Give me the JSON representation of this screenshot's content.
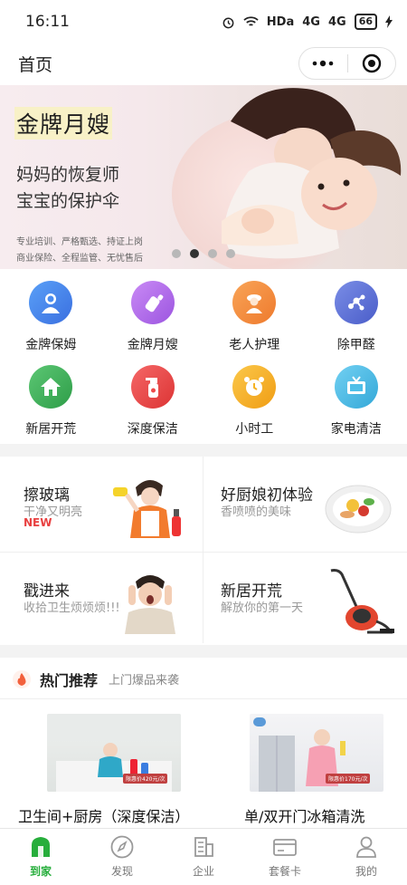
{
  "status_bar": {
    "time": "16:11",
    "network": "HDa",
    "signal1": "4G",
    "signal2": "4G",
    "battery": "66"
  },
  "navbar": {
    "title": "首页"
  },
  "banner": {
    "headline": "金牌月嫂",
    "line1": "妈妈的恢复师",
    "line2": "宝宝的保护伞",
    "small1": "专业培训、严格甄选、持证上岗",
    "small2": "商业保险、全程监管、无忧售后",
    "page_count": 4,
    "current_page": 2
  },
  "services": [
    {
      "label": "金牌保姆",
      "icon": "nanny-icon",
      "color": "#4a8cf0"
    },
    {
      "label": "金牌月嫂",
      "icon": "baby-bottle-icon",
      "color": "#b06ae8"
    },
    {
      "label": "老人护理",
      "icon": "elderly-care-icon",
      "color": "#f48a3a"
    },
    {
      "label": "除甲醛",
      "icon": "molecule-icon",
      "color": "#5b6fd8"
    },
    {
      "label": "新居开荒",
      "icon": "house-icon",
      "color": "#3fb35a"
    },
    {
      "label": "深度保洁",
      "icon": "spray-bottle-icon",
      "color": "#ee4a4a"
    },
    {
      "label": "小时工",
      "icon": "alarm-clock-icon",
      "color": "#f5b324"
    },
    {
      "label": "家电清洁",
      "icon": "tv-icon",
      "color": "#4fbfe8"
    }
  ],
  "promos": [
    {
      "title": "擦玻璃",
      "subtitle": "干净又明亮",
      "badge": "NEW",
      "image": "window-cleaning-icon"
    },
    {
      "title": "好厨娘初体验",
      "subtitle": "香喷喷的美味",
      "badge": "",
      "image": "dish-icon"
    },
    {
      "title": "戳进来",
      "subtitle": "收拾卫生烦烦烦!!!",
      "badge": "",
      "image": "frustrated-man-icon"
    },
    {
      "title": "新居开荒",
      "subtitle": "解放你的第一天",
      "badge": "",
      "image": "vacuum-cleaner-icon"
    }
  ],
  "hot": {
    "title": "热门推荐",
    "subtitle": "上门爆品来袭"
  },
  "products": [
    {
      "name": "卫生间+厨房（深度保洁）",
      "price_tag": "限惠价420元/次"
    },
    {
      "name": "单/双开门冰箱清洗",
      "price_tag": "限惠价170元/次"
    }
  ],
  "tabs": [
    {
      "label": "到家",
      "icon": "home-icon",
      "active": true
    },
    {
      "label": "发现",
      "icon": "compass-icon",
      "active": false
    },
    {
      "label": "企业",
      "icon": "building-icon",
      "active": false
    },
    {
      "label": "套餐卡",
      "icon": "card-icon",
      "active": false
    },
    {
      "label": "我的",
      "icon": "user-icon",
      "active": false
    }
  ],
  "colors": {
    "accent": "#27ae3c",
    "new_badge": "#e84040"
  }
}
